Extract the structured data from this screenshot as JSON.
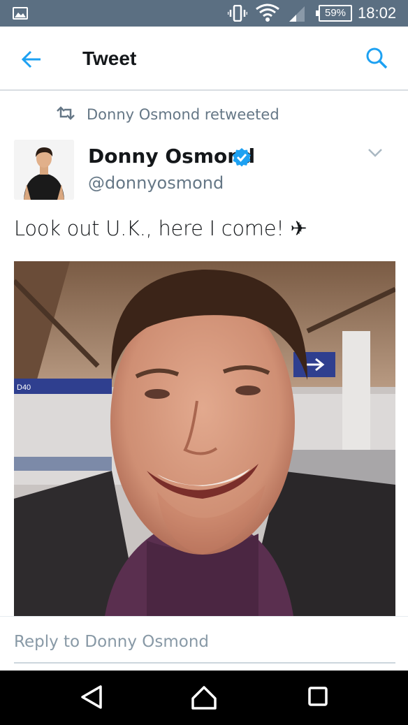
{
  "status_bar": {
    "battery": "59%",
    "time": "18:02",
    "icons": [
      "gallery-icon",
      "vibrate-icon",
      "wifi-icon",
      "signal-icon",
      "battery-icon"
    ]
  },
  "app_bar": {
    "title": "Tweet",
    "back_icon": "back-arrow-icon",
    "search_icon": "search-icon",
    "accent_color": "#1da1f2"
  },
  "tweet": {
    "retweet_context": "Donny Osmond retweeted",
    "author_name": "Donny Osmond",
    "author_handle": "@donnyosmond",
    "verified": true,
    "text": "Look out U.K., here I come! ✈"
  },
  "reply": {
    "placeholder": "Reply to Donny Osmond"
  },
  "nav_bar": {
    "icons": [
      "nav-back-icon",
      "nav-home-icon",
      "nav-recent-icon"
    ]
  }
}
